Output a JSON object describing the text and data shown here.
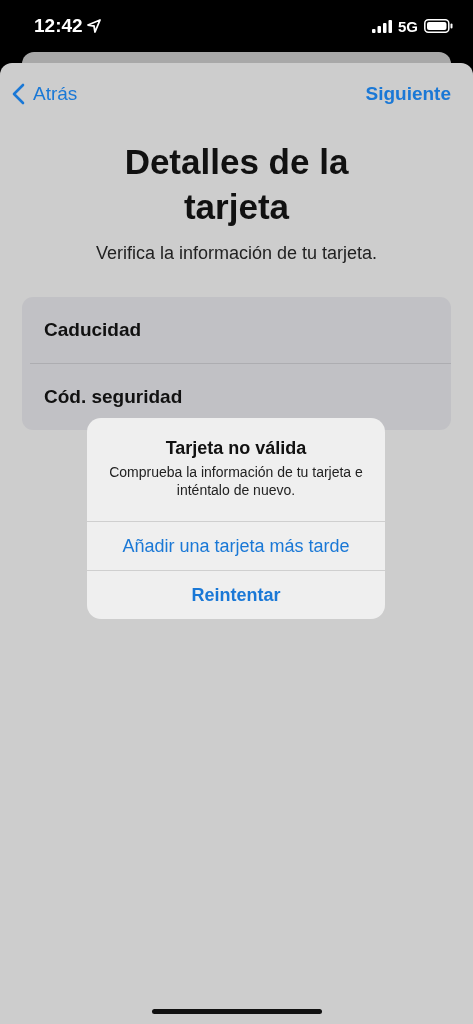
{
  "status_bar": {
    "time": "12:42",
    "network": "5G"
  },
  "nav": {
    "back": "Atrás",
    "next": "Siguiente"
  },
  "title": "Detalles de la tarjeta",
  "subtitle": "Verifica la información de tu tarjeta.",
  "fields": [
    {
      "label": "Caducidad"
    },
    {
      "label": "Cód. seguridad"
    }
  ],
  "alert": {
    "title": "Tarjeta no válida",
    "message": "Comprueba la información de tu tarjeta e inténtalo de nuevo.",
    "actions": [
      {
        "label": "Añadir una tarjeta más tarde",
        "kind": "default"
      },
      {
        "label": "Reintentar",
        "kind": "preferred"
      }
    ]
  }
}
